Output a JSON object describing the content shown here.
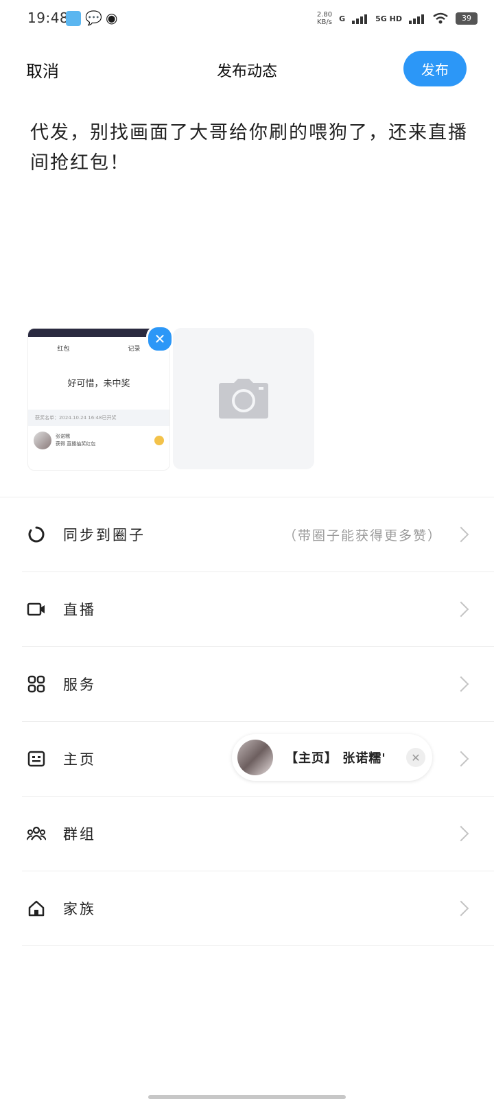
{
  "status_bar": {
    "time": "19:48",
    "net_speed_value": "2.80",
    "net_speed_unit": "KB/s",
    "signal_1": "G",
    "signal_2": "5G HD",
    "battery": "39"
  },
  "header": {
    "cancel_label": "取消",
    "title": "发布动态",
    "publish_label": "发布"
  },
  "post": {
    "text": "代发，别找画面了大哥给你刷的喂狗了，还来直播间抢红包！"
  },
  "attachment": {
    "tab_1": "红包",
    "tab_2": "记录",
    "headline": "好可惜，未中奖",
    "info_bar": "获奖名单：2024.10.24 16:48已开奖",
    "winner_name": "张诺糯",
    "winner_note": "获得 直播抽奖红包"
  },
  "settings": [
    {
      "icon": "circle-sync-icon",
      "label": "同步到圈子",
      "hint": "（带圈子能获得更多赞）"
    },
    {
      "icon": "video-camera-icon",
      "label": "直播",
      "hint": ""
    },
    {
      "icon": "grid-apps-icon",
      "label": "服务",
      "hint": ""
    },
    {
      "icon": "id-card-icon",
      "label": "主页",
      "hint": ""
    },
    {
      "icon": "group-people-icon",
      "label": "群组",
      "hint": ""
    },
    {
      "icon": "home-icon",
      "label": "家族",
      "hint": ""
    }
  ],
  "home_chip": {
    "text": "【主页】 张诺糯'"
  },
  "colors": {
    "accent": "#2c97f7",
    "divider": "#ececec",
    "hint_text": "#9a9a9a"
  }
}
